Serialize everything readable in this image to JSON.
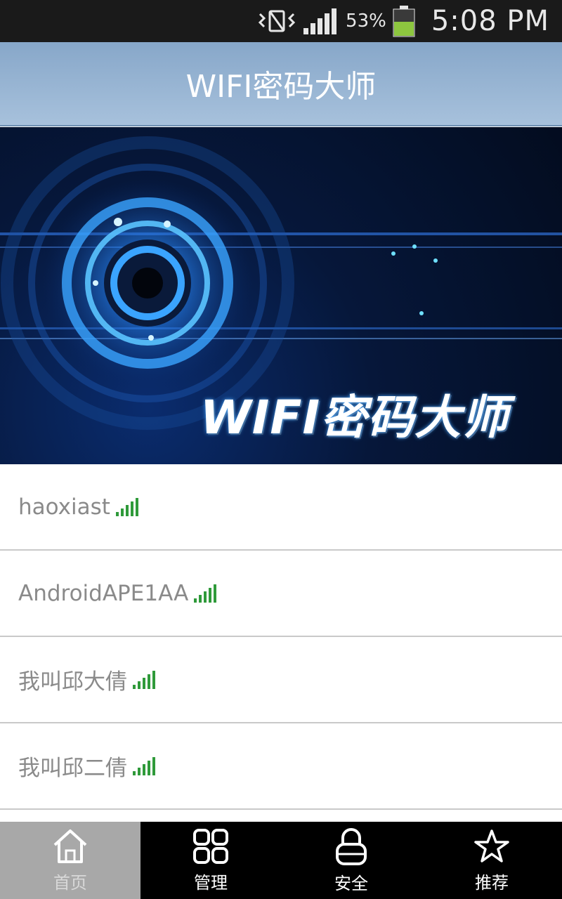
{
  "status_bar": {
    "battery": "53%",
    "time": "5:08 PM",
    "icons": [
      "vibrate-icon",
      "cell-signal-icon",
      "battery-icon"
    ],
    "battery_color": "#8dc63f"
  },
  "header": {
    "title": "WIFI密码大师",
    "bg_color": "#94b3d3"
  },
  "banner": {
    "text": "WIFI密码大师"
  },
  "networks": [
    {
      "name": "haoxiast",
      "signal_level": 5
    },
    {
      "name": "AndroidAPE1AA",
      "signal_level": 5
    },
    {
      "name": "我叫邱大倩",
      "signal_level": 5
    },
    {
      "name": "我叫邱二倩",
      "signal_level": 5
    }
  ],
  "bottom_nav": {
    "tabs": [
      {
        "label": "首页",
        "icon": "home-icon",
        "active": true
      },
      {
        "label": "管理",
        "icon": "grid-icon",
        "active": false
      },
      {
        "label": "安全",
        "icon": "lock-icon",
        "active": false
      },
      {
        "label": "推荐",
        "icon": "star-icon",
        "active": false
      }
    ]
  },
  "colors": {
    "signal": "#2f9a3a",
    "nav_active": "#a8a8a8",
    "nav_bg": "#000000"
  }
}
